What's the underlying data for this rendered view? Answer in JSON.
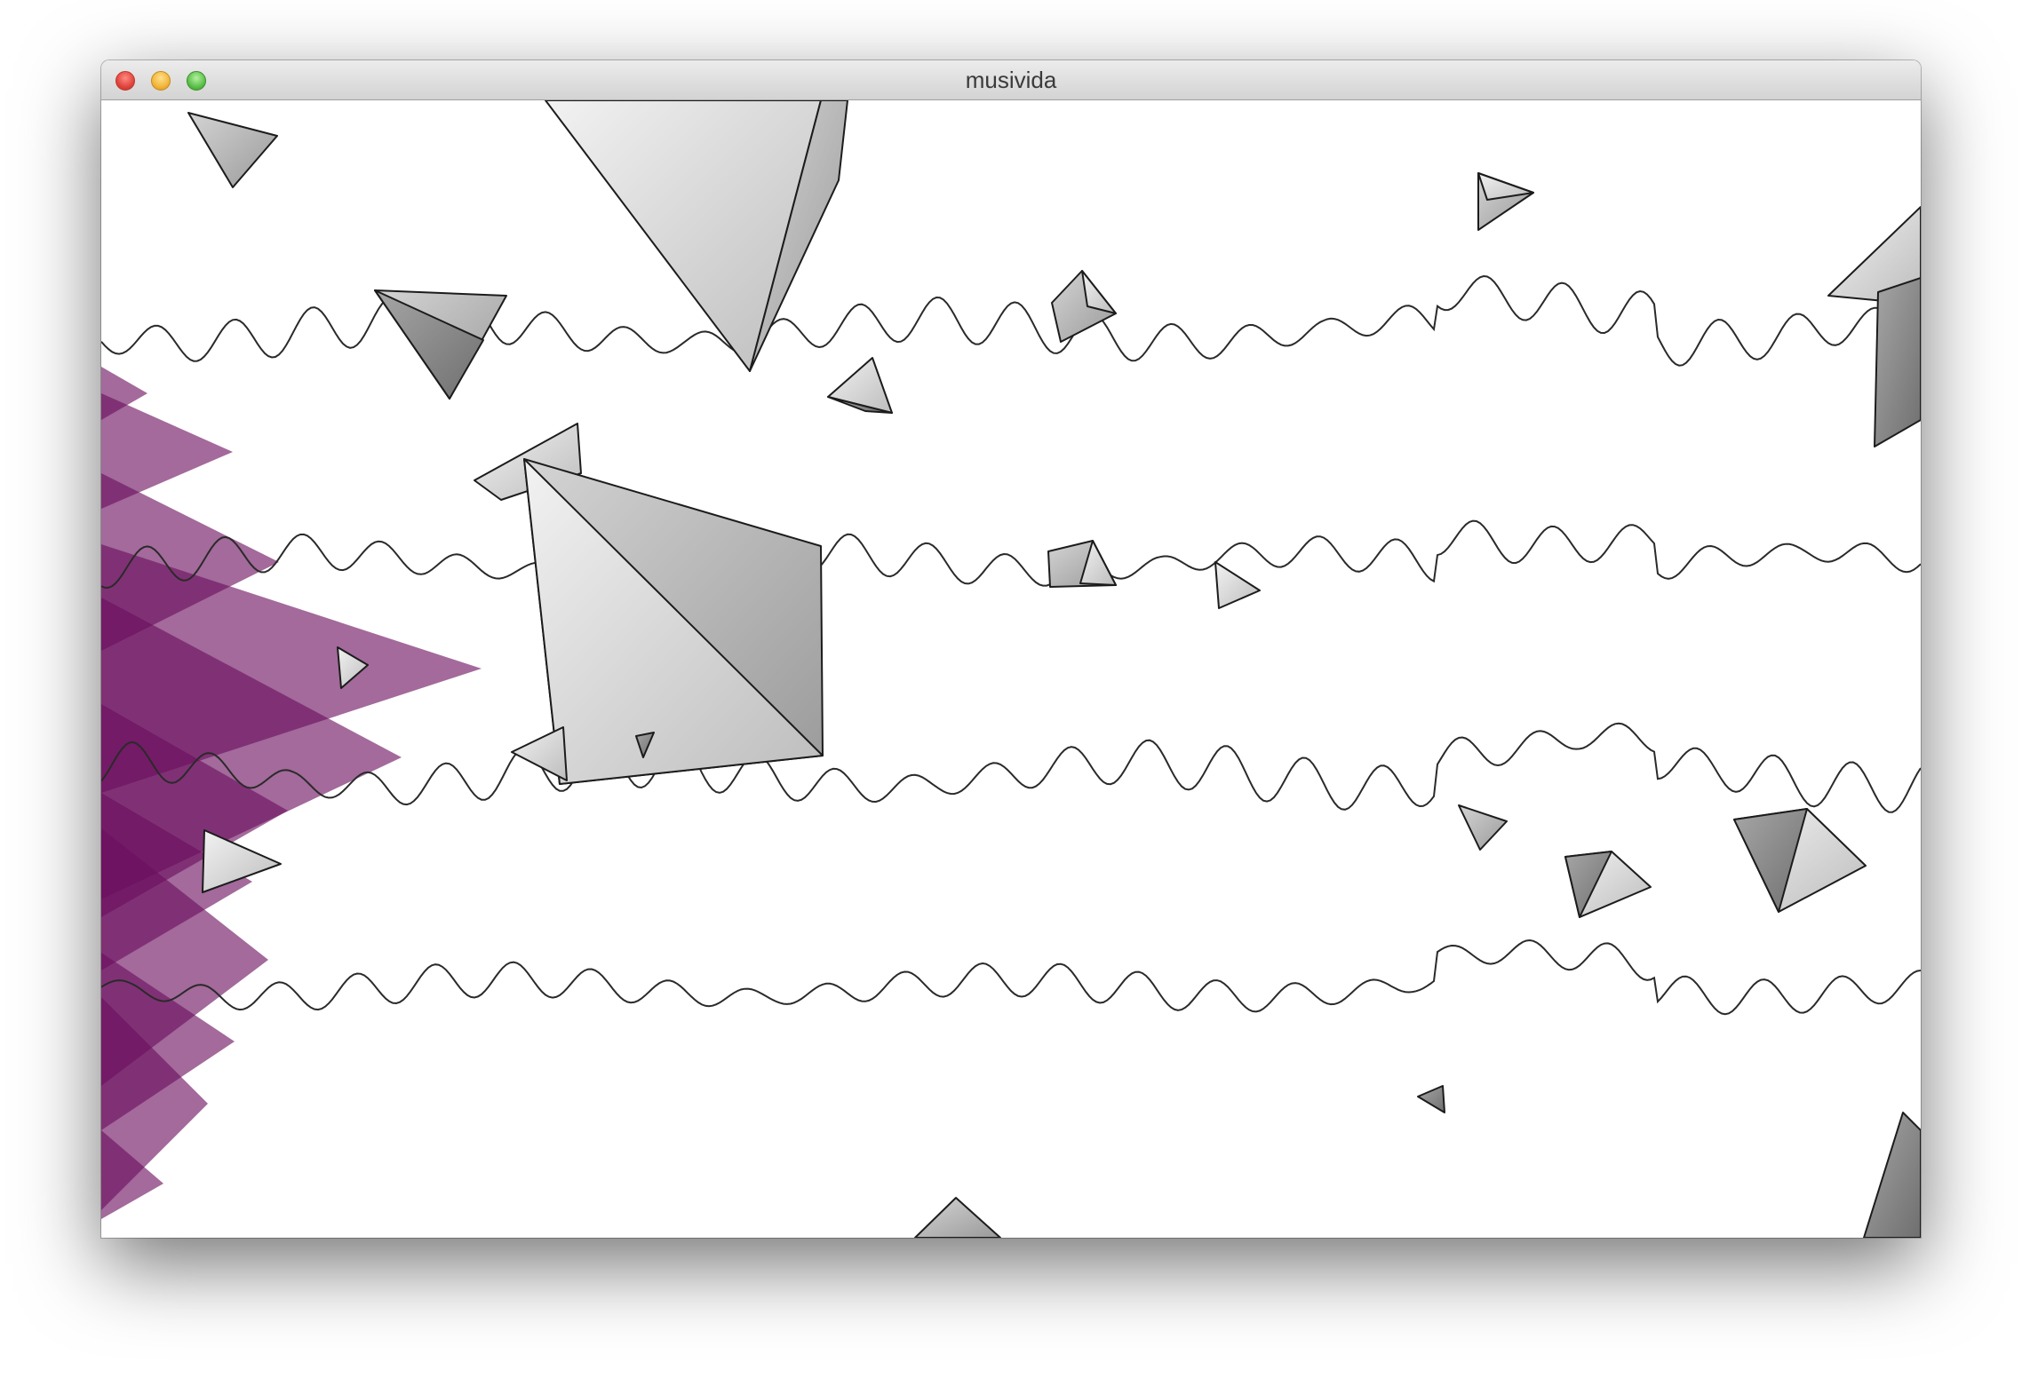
{
  "window": {
    "title": "musivida"
  },
  "colors": {
    "purple": "#6b0f5e",
    "waveform": "#2a2a2a",
    "shape_light": "#d9d9d9",
    "shape_dark": "#8a8a8a",
    "titlebar": "#e2e2e2"
  },
  "icons": {
    "close": "close-icon",
    "minimize": "minimize-icon",
    "zoom": "zoom-icon"
  }
}
